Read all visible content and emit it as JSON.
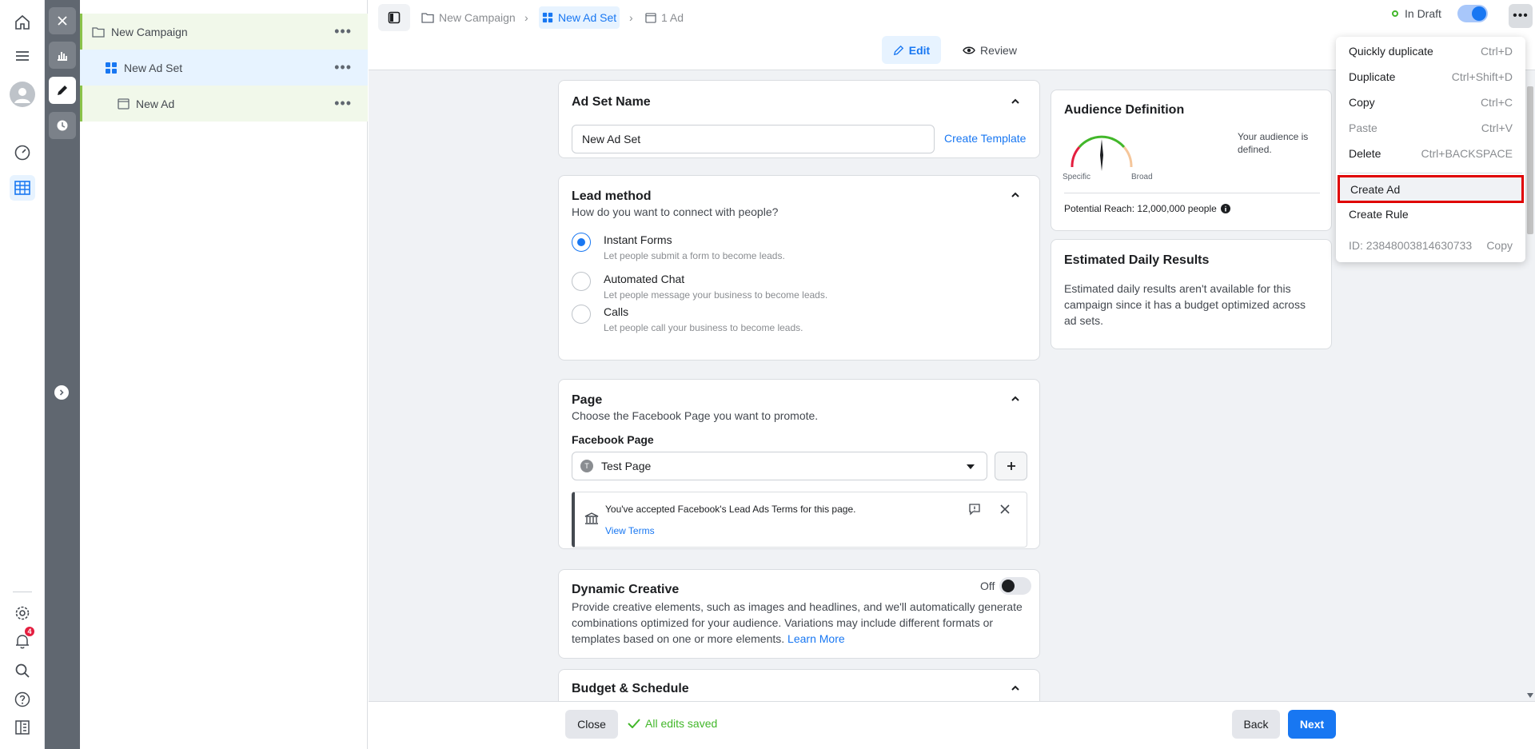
{
  "breadcrumb": {
    "campaign": "New Campaign",
    "adset": "New Ad Set",
    "ad": "1 Ad"
  },
  "tabs": {
    "edit": "Edit",
    "review": "Review"
  },
  "status": {
    "label": "In Draft",
    "toggle_on": true
  },
  "rail": {
    "notification_count": "4"
  },
  "tree": {
    "campaign": "New Campaign",
    "adset": "New Ad Set",
    "ad": "New Ad",
    "more": "•••"
  },
  "adset_name": {
    "title": "Ad Set Name",
    "value": "New Ad Set",
    "create_template": "Create Template"
  },
  "lead_method": {
    "title": "Lead method",
    "subtitle": "How do you want to connect with people?",
    "options": [
      {
        "label": "Instant Forms",
        "desc": "Let people submit a form to become leads.",
        "selected": true
      },
      {
        "label": "Automated Chat",
        "desc": "Let people message your business to become leads.",
        "selected": false
      },
      {
        "label": "Calls",
        "desc": "Let people call your business to become leads.",
        "selected": false
      }
    ]
  },
  "page": {
    "title": "Page",
    "subtitle": "Choose the Facebook Page you want to promote.",
    "fb_page_label": "Facebook Page",
    "selected_page": "Test Page",
    "page_initial": "T",
    "terms_text": "You've accepted Facebook's Lead Ads Terms for this page.",
    "view_terms": "View Terms"
  },
  "dynamic_creative": {
    "title": "Dynamic Creative",
    "toggle_label": "Off",
    "desc": "Provide creative elements, such as images and headlines, and we'll automatically generate combinations optimized for your audience. Variations may include different formats or templates based on one or more elements.",
    "learn_more": "Learn More"
  },
  "budget": {
    "title": "Budget & Schedule"
  },
  "audience": {
    "title": "Audience Definition",
    "status": "Your audience is defined.",
    "specific": "Specific",
    "broad": "Broad",
    "reach": "Potential Reach: 12,000,000 people"
  },
  "estimated": {
    "title": "Estimated Daily Results",
    "desc": "Estimated daily results aren't available for this campaign since it has a budget optimized across ad sets."
  },
  "menu": {
    "items": [
      {
        "label": "Quickly duplicate",
        "shortcut": "Ctrl+D"
      },
      {
        "label": "Duplicate",
        "shortcut": "Ctrl+Shift+D"
      },
      {
        "label": "Copy",
        "shortcut": "Ctrl+C"
      },
      {
        "label": "Paste",
        "shortcut": "Ctrl+V"
      },
      {
        "label": "Delete",
        "shortcut": "Ctrl+BACKSPACE"
      },
      {
        "label": "Create Ad",
        "shortcut": ""
      },
      {
        "label": "Create Rule",
        "shortcut": ""
      }
    ],
    "id_label": "ID: 23848003814630733",
    "copy_id": "Copy"
  },
  "footer": {
    "close": "Close",
    "saved": "All edits saved",
    "back": "Back",
    "next": "Next"
  },
  "colors": {
    "accent": "#1877f2",
    "highlight": "#e00000",
    "success": "#42b72a"
  }
}
